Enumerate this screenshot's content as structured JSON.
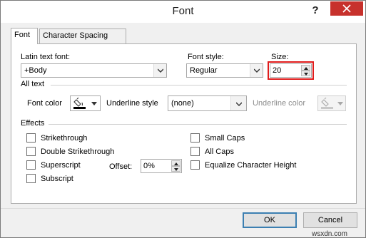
{
  "window": {
    "title": "Font",
    "help_label": "?"
  },
  "tabs": [
    {
      "label": "Font",
      "active": true
    },
    {
      "label": "Character Spacing",
      "active": false
    }
  ],
  "latin_font": {
    "label": "Latin text font:",
    "value": "+Body"
  },
  "font_style": {
    "label": "Font style:",
    "value": "Regular"
  },
  "size": {
    "label": "Size:",
    "value": "20",
    "highlight_color": "#e01b1b"
  },
  "all_text": {
    "heading": "All text",
    "font_color_label": "Font color",
    "font_color_value": "#000000",
    "underline_style_label": "Underline style",
    "underline_style_value": "(none)",
    "underline_color_label": "Underline color"
  },
  "effects": {
    "heading": "Effects",
    "strikethrough": "Strikethrough",
    "double_strikethrough": "Double Strikethrough",
    "superscript": "Superscript",
    "subscript": "Subscript",
    "offset_label": "Offset:",
    "offset_value": "0%",
    "small_caps": "Small Caps",
    "all_caps": "All Caps",
    "equalize": "Equalize Character Height"
  },
  "buttons": {
    "ok": "OK",
    "cancel": "Cancel"
  },
  "watermark": "wsxdn.com",
  "colors": {
    "close_bg": "#c7312c",
    "default_border": "#3c7fb1"
  }
}
